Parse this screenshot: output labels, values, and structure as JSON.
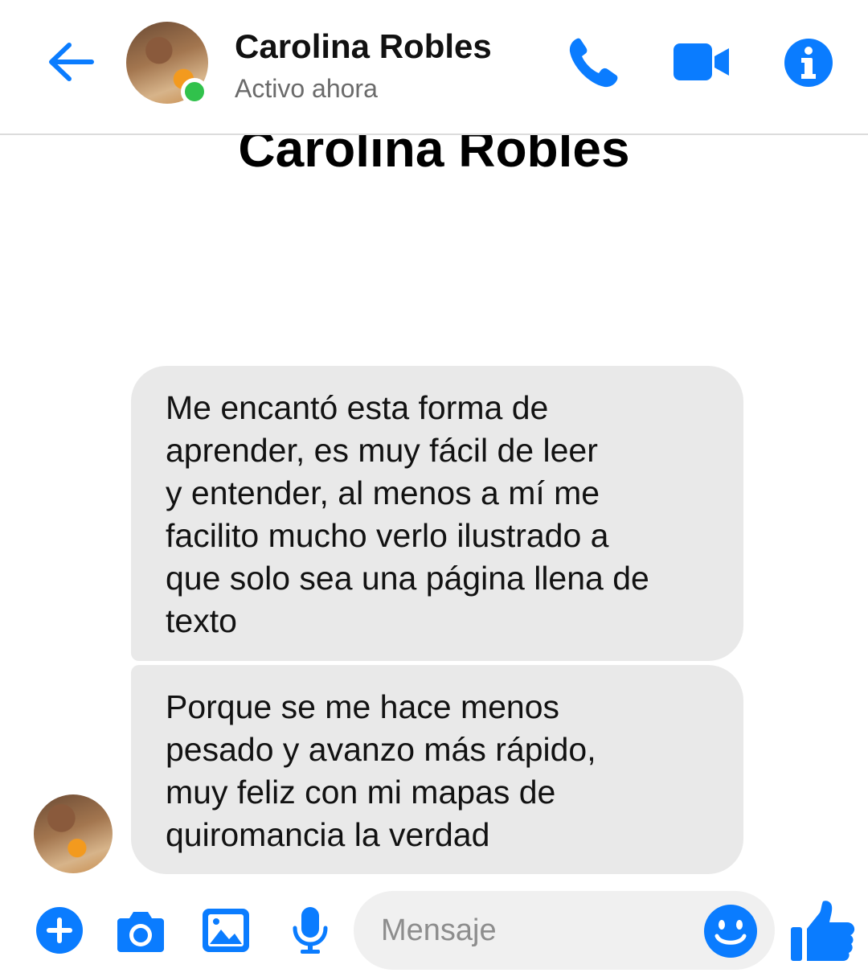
{
  "header": {
    "contact_name": "Carolina Robles",
    "status": "Activo ahora",
    "icons": [
      "back-arrow-icon",
      "phone-icon",
      "video-camera-icon",
      "info-icon"
    ]
  },
  "background_name": "Carolina Robles",
  "messages": [
    {
      "lines": [
        "Me encantó esta forma de",
        "aprender, es muy fácil de leer",
        "y entender, al menos a mí me",
        "facilito mucho verlo ilustrado a",
        "que solo sea una página llena de",
        "texto"
      ]
    },
    {
      "lines": [
        "Porque se me hace menos",
        "pesado y avanzo más rápido,",
        "muy feliz con mi mapas de",
        "quiromancia la verdad"
      ]
    }
  ],
  "composer": {
    "placeholder": "Mensaje",
    "icons": [
      "plus-icon",
      "camera-icon",
      "image-icon",
      "microphone-icon",
      "emoji-icon",
      "thumbs-up-icon"
    ]
  },
  "colors": {
    "accent": "#0a7cff",
    "bubble": "#e9e9e9",
    "online": "#31c24c"
  }
}
